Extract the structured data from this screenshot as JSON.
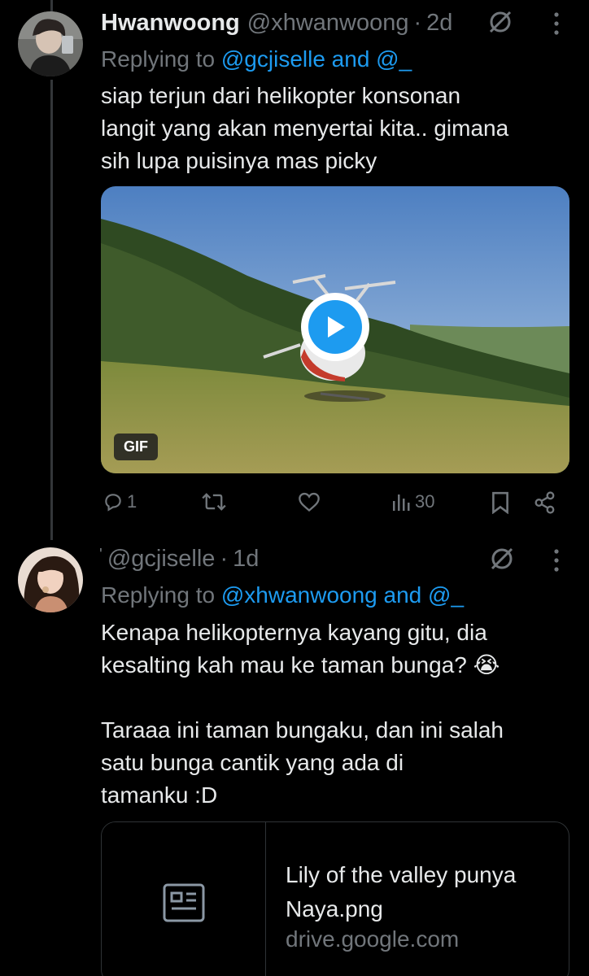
{
  "tweet1": {
    "display_name": "Hwanwoong",
    "handle": "@xhwanwoong",
    "separator": "·",
    "time": "2d",
    "replying_prefix": "Replying to ",
    "replying_to": "@gcjiselle and @_",
    "text": "siap terjun dari helikopter konsonan\nlangit yang akan menyertai kita.. gimana\nsih lupa puisinya mas picky",
    "media_badge": "GIF",
    "actions": {
      "replies": "1",
      "retweets": "",
      "likes": "",
      "views": "30"
    }
  },
  "tweet2": {
    "display_name": "'",
    "handle": "@gcjiselle",
    "separator": "·",
    "time": "1d",
    "replying_prefix": "Replying to ",
    "replying_to": "@xhwanwoong and @_",
    "text_1": "Kenapa helikopternya kayang gitu, dia\nkesalting kah mau ke taman bunga? 😭",
    "text_2": "Taraaa ini taman bungaku, dan ini salah\nsatu bunga cantik yang ada di\ntamanku :D",
    "card": {
      "title": "Lily of the valley punya Naya.png",
      "domain": "drive.google.com",
      "thumb_icon": "document-card-icon"
    }
  },
  "colors": {
    "background": "#000000",
    "text": "#e7e9ea",
    "muted": "#71767b",
    "link": "#1d9bf0",
    "border": "#2f3336"
  },
  "icons": {
    "grok": "grok-icon",
    "more": "more-dots-icon",
    "reply": "reply-icon",
    "retweet": "retweet-icon",
    "like": "heart-icon",
    "views": "views-bar-icon",
    "bookmark": "bookmark-icon",
    "share": "share-icon",
    "play": "play-icon"
  }
}
